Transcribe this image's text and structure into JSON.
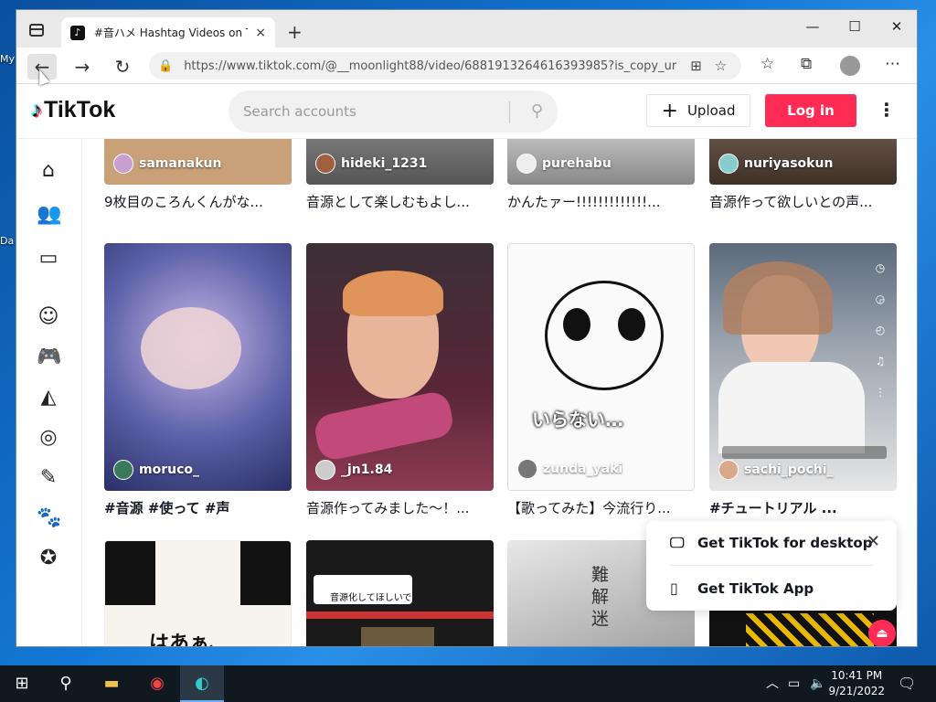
{
  "desktop": {
    "icon1_label": "My",
    "icon2_label": "Da"
  },
  "browser": {
    "tab_title": "#音ハメ Hashtag Videos on TikTok",
    "tab_close": "×",
    "new_tab": "+",
    "url": "https://www.tiktok.com/@__moonlight88/video/6881913264616393985?is_copy_url..."
  },
  "tiktok": {
    "logo": "TikTok",
    "search_placeholder": "Search accounts",
    "upload_label": "Upload",
    "login_label": "Log in",
    "sidebar_icons": [
      "home-icon",
      "following-icon",
      "live-icon",
      "comedy-icon",
      "gaming-icon",
      "food-icon",
      "places-icon",
      "beauty-icon",
      "animals-icon",
      "sports-icon"
    ]
  },
  "videos": [
    {
      "user": "samanakun",
      "desc": "9枚目のころんくんがな...",
      "color": "#c9a178"
    },
    {
      "user": "hideki_1231",
      "desc": "音源として楽しむもよし...",
      "color": "#7b7b7b"
    },
    {
      "user": "purehabu",
      "desc": "かんたァー!!!!!!!!!!!!!...",
      "color": "#d9d9d9"
    },
    {
      "user": "nuriyasokun",
      "desc": "音源作って欲しいとの声...",
      "color": "#6d5a4b"
    },
    {
      "user": "moruco_",
      "desc": "#音源 #使って #声",
      "color": "#6b74b8"
    },
    {
      "user": "_jn1.84",
      "desc": "音源作ってみました～！...",
      "color": "#8e3b54"
    },
    {
      "user": "zunda_yaki",
      "desc": "【歌ってみた】今流行り...",
      "color": "#f2f2f2"
    },
    {
      "user": "sachi_pochi_",
      "desc": "#チュートリアル ...",
      "color": "#b8b2ad"
    },
    {
      "user": "",
      "desc": "",
      "color": "#f4f0e8"
    },
    {
      "user": "",
      "desc": "",
      "color": "#222222"
    },
    {
      "user": "",
      "desc": "",
      "color": "#c8c8c8"
    },
    {
      "user": "",
      "desc": "",
      "color": "#111111"
    }
  ],
  "overlay_texts": {
    "zunda": "いらない…",
    "bottom_left": "はあぁ、",
    "request": "音源化してほしいです",
    "vertical": "難解迷"
  },
  "popup": {
    "desktop_label": "Get TikTok for desktop",
    "app_label": "Get TikTok App"
  },
  "taskbar": {
    "time": "10:41 PM",
    "date": "9/21/2022"
  },
  "colors": {
    "accent": "#fe2c55",
    "taskbar": "#101820"
  }
}
